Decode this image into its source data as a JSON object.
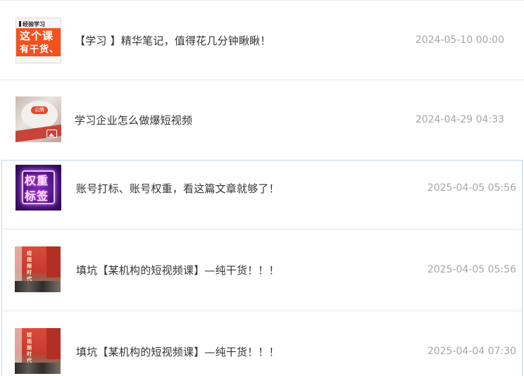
{
  "articles": [
    {
      "thumb_lines": [
        "经验学习",
        "这个课",
        "有干货、"
      ],
      "title": "【学习 】精华笔记，值得花几分钟瞅瞅！",
      "date": "2024-05-10 00:00"
    },
    {
      "thumb_logo": "公牌",
      "thumb_icon": "image-placeholder-icon",
      "title": "学习企业怎么做爆短视频",
      "date": "2024-04-29 04:33"
    },
    {
      "thumb_lines": [
        "权重",
        "标签"
      ],
      "title": "账号打标、账号权重，看这篇文章就够了！",
      "date": "2025-04-05 05:56"
    },
    {
      "thumb_text": "短视频时代",
      "title": "填坑【某机构的短视频课】—纯干货！！！",
      "date": "2025-04-05 05:56"
    },
    {
      "thumb_text": "短视频时代",
      "title": "填坑【某机构的短视频课】—纯干货！！！",
      "date": "2025-04-04 07:30"
    }
  ],
  "colors": {
    "panel_border": "#bcd9f2",
    "date_text": "#a6a6a6",
    "title_text": "#333333"
  }
}
